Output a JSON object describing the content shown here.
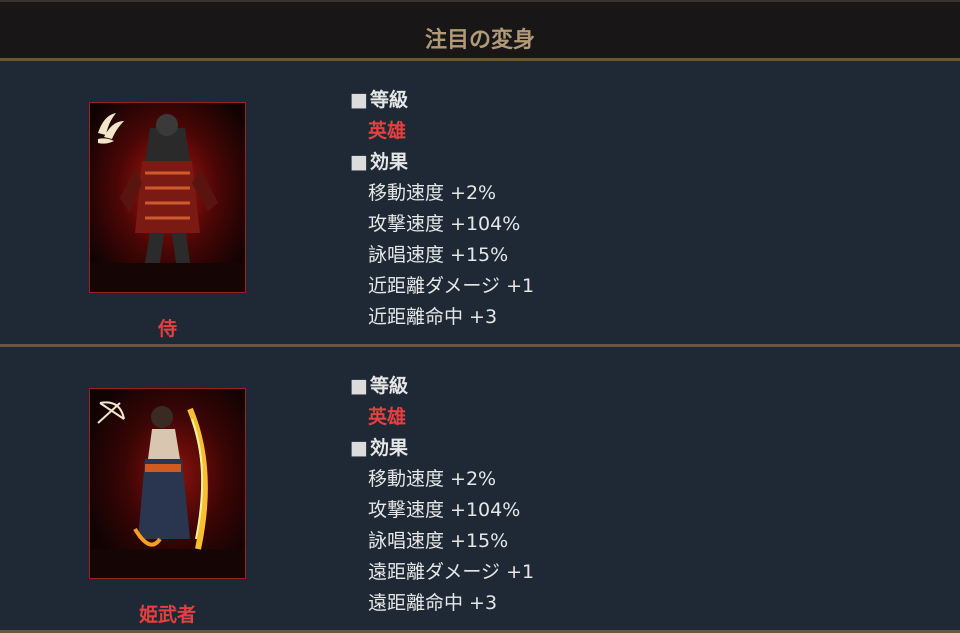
{
  "header": {
    "title": "注目の変身"
  },
  "labels": {
    "square": "■",
    "grade": "等級",
    "effect": "効果"
  },
  "cards": [
    {
      "name": "侍",
      "grade": "英雄",
      "weapon_icon": "wings-icon",
      "effects": [
        "移動速度 +2%",
        "攻撃速度 +104%",
        "詠唱速度 +15%",
        "近距離ダメージ +1",
        "近距離命中 +3"
      ]
    },
    {
      "name": "姫武者",
      "grade": "英雄",
      "weapon_icon": "bow-icon",
      "effects": [
        "移動速度 +2%",
        "攻撃速度 +104%",
        "詠唱速度 +15%",
        "遠距離ダメージ +1",
        "遠距離命中 +3"
      ]
    }
  ],
  "colors": {
    "grade_red": "#e44040",
    "header_gold": "#b09a78",
    "panel_bg": "#1f2935"
  }
}
